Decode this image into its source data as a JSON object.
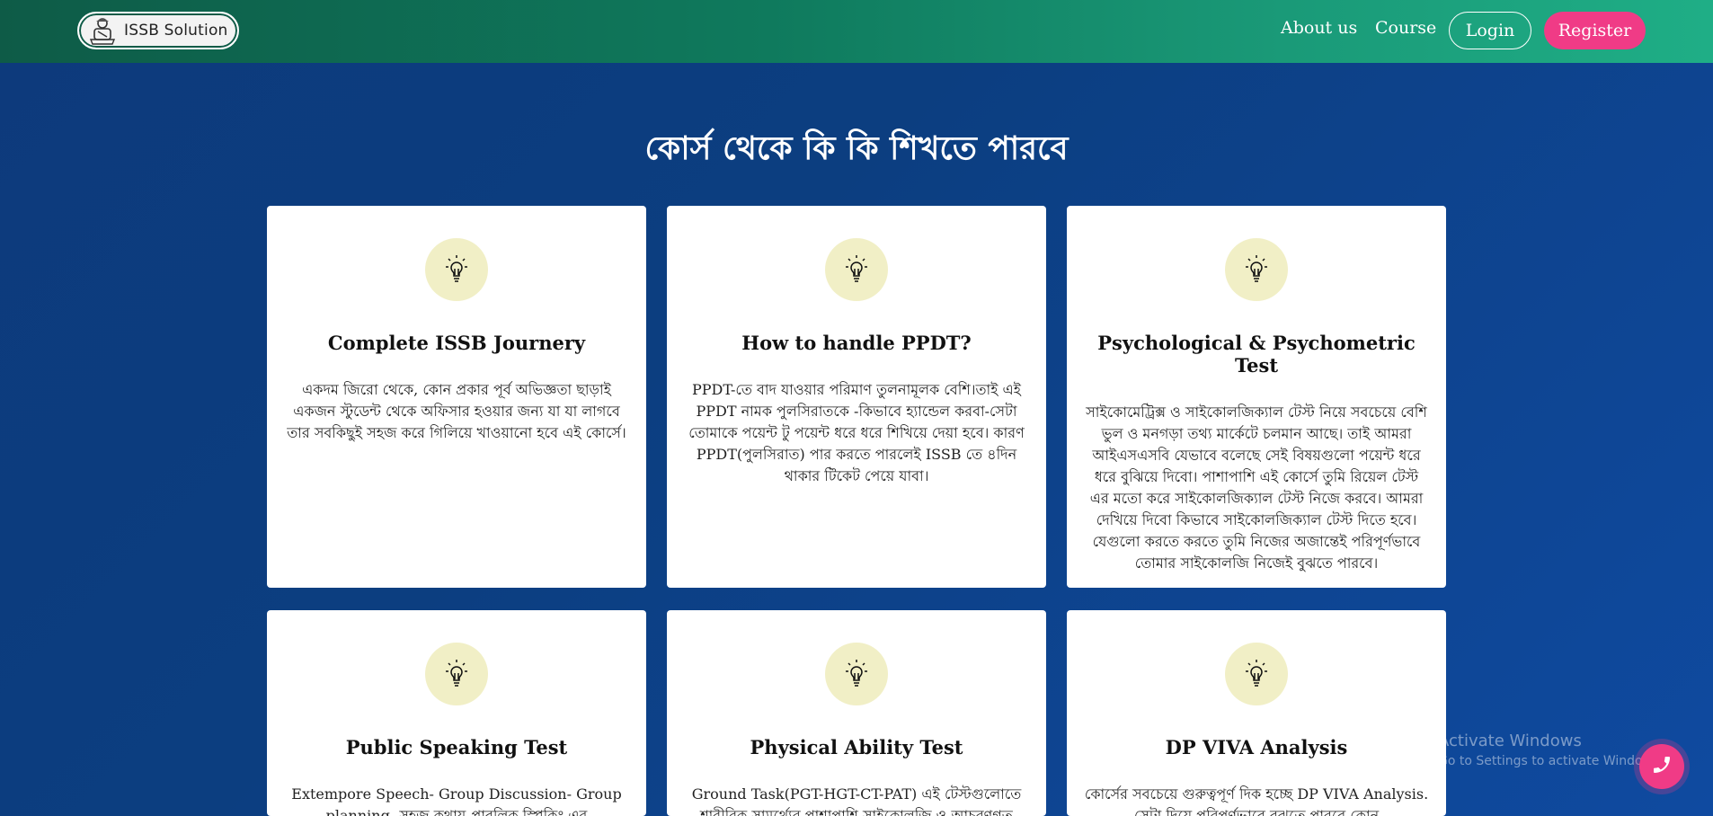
{
  "brand": {
    "name": "ISSB Solution",
    "logo_icon": "soldier-emblem-icon"
  },
  "nav": {
    "links": [
      {
        "label": "About us"
      },
      {
        "label": "Course"
      }
    ],
    "login_label": "Login",
    "register_label": "Register"
  },
  "section": {
    "title": "কোর্স থেকে কি কি শিখতে পারবে"
  },
  "cards": [
    {
      "icon": "lightbulb-icon",
      "title": "Complete ISSB Journery",
      "text": "একদম জিরো থেকে, কোন প্রকার পূর্ব অভিজ্ঞতা ছাড়াই একজন স্টুডেন্ট থেকে অফিসার হওয়ার জন্য যা যা লাগবে তার সবকিছুই সহজ করে গিলিয়ে খাওয়ানো হবে এই কোর্সে।"
    },
    {
      "icon": "lightbulb-icon",
      "title": "How to handle PPDT?",
      "text": "PPDT-তে বাদ যাওয়ার পরিমাণ তুলনামূলক বেশি।তাই এই PPDT নামক পুলসিরাতকে -কিভাবে হ্যান্ডেল করবা-সেটা তোমাকে পয়েন্ট টু পয়েন্ট ধরে ধরে শিখিয়ে দেয়া হবে। কারণ PPDT(পুলসিরাত) পার করতে পারলেই ISSB তে ৪দিন থাকার টিকেট পেয়ে যাবা।"
    },
    {
      "icon": "lightbulb-icon",
      "title": "Psychological & Psychometric Test",
      "text": "সাইকোমেট্রিক্স ও সাইকোলজিক্যাল টেস্ট নিয়ে সবচেয়ে বেশি ভুল ও মনগড়া তথ্য মার্কেটে চলমান আছে। তাই আমরা আইএসএসবি যেভাবে বলেছে সেই বিষয়গুলো পয়েন্ট ধরে ধরে বুঝিয়ে দিবো। পাশাপাশি এই কোর্সে তুমি রিয়েল টেস্ট এর মতো করে সাইকোলজিক্যাল টেস্ট নিজে করবে। আমরা দেখিয়ে দিবো কিভাবে সাইকোলজিক্যাল টেস্ট দিতে হবে। যেগুলো করতে করতে তুমি নিজের অজান্তেই পরিপূর্ণভাবে তোমার সাইকোলজি নিজেই বুঝতে পারবে।"
    },
    {
      "icon": "lightbulb-icon",
      "title": "Public Speaking Test",
      "text": "Extempore Speech- Group Discussion- Group planning- সহজ কথায় প্রাবলিক স্পিকিং এর"
    },
    {
      "icon": "lightbulb-icon",
      "title": "Physical Ability Test",
      "text": "Ground Task(PGT-HGT-CT-PAT) এই টেস্টগুলোতে শারীরিক সামর্থ্যের পাশাপাশি সাইকোলজি ও আচরণগত"
    },
    {
      "icon": "lightbulb-icon",
      "title": "DP VIVA Analysis",
      "text": "কোর্সের সবচেয়ে গুরুত্বপূর্ণ দিক হচ্ছে DP VIVA Analysis. সেটা দিয়ে পরিপূর্ণভাবে বুঝতে পারবে কোন"
    }
  ],
  "watermark": {
    "line1": "Activate Windows",
    "line2": "Go to Settings to activate Windows."
  },
  "floating": {
    "icon": "phone-icon"
  }
}
